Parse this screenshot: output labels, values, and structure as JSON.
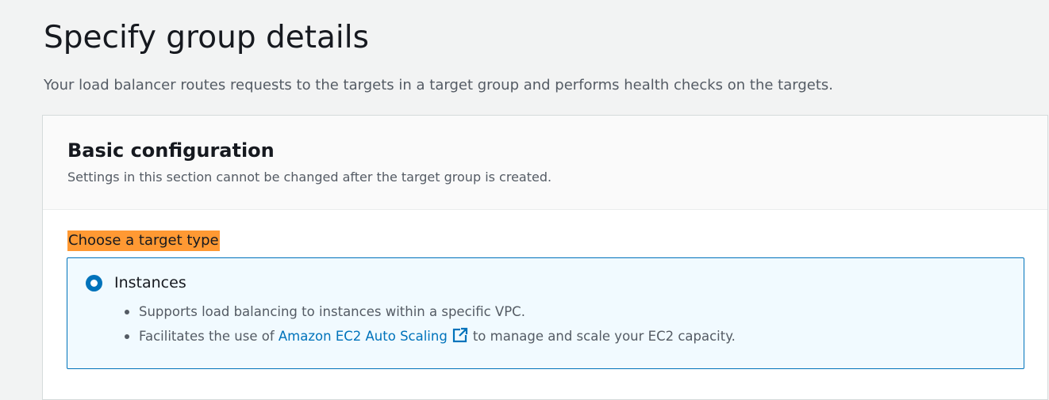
{
  "page": {
    "title": "Specify group details",
    "description": "Your load balancer routes requests to the targets in a target group and performs health checks on the targets."
  },
  "basic_configuration": {
    "title": "Basic configuration",
    "subtitle": "Settings in this section cannot be changed after the target group is created.",
    "target_type_label": "Choose a target type",
    "option": {
      "label": "Instances",
      "selected": true,
      "bullet_1": "Supports load balancing to instances within a specific VPC.",
      "bullet_2_prefix": "Facilitates the use of ",
      "bullet_2_link": "Amazon EC2 Auto Scaling",
      "bullet_2_link_icon": "external-link-icon",
      "bullet_2_suffix": "to manage and scale your EC2 capacity."
    }
  },
  "colors": {
    "accent": "#0073bb",
    "highlight": "#ff9933",
    "selected_card_bg": "#f1faff"
  }
}
